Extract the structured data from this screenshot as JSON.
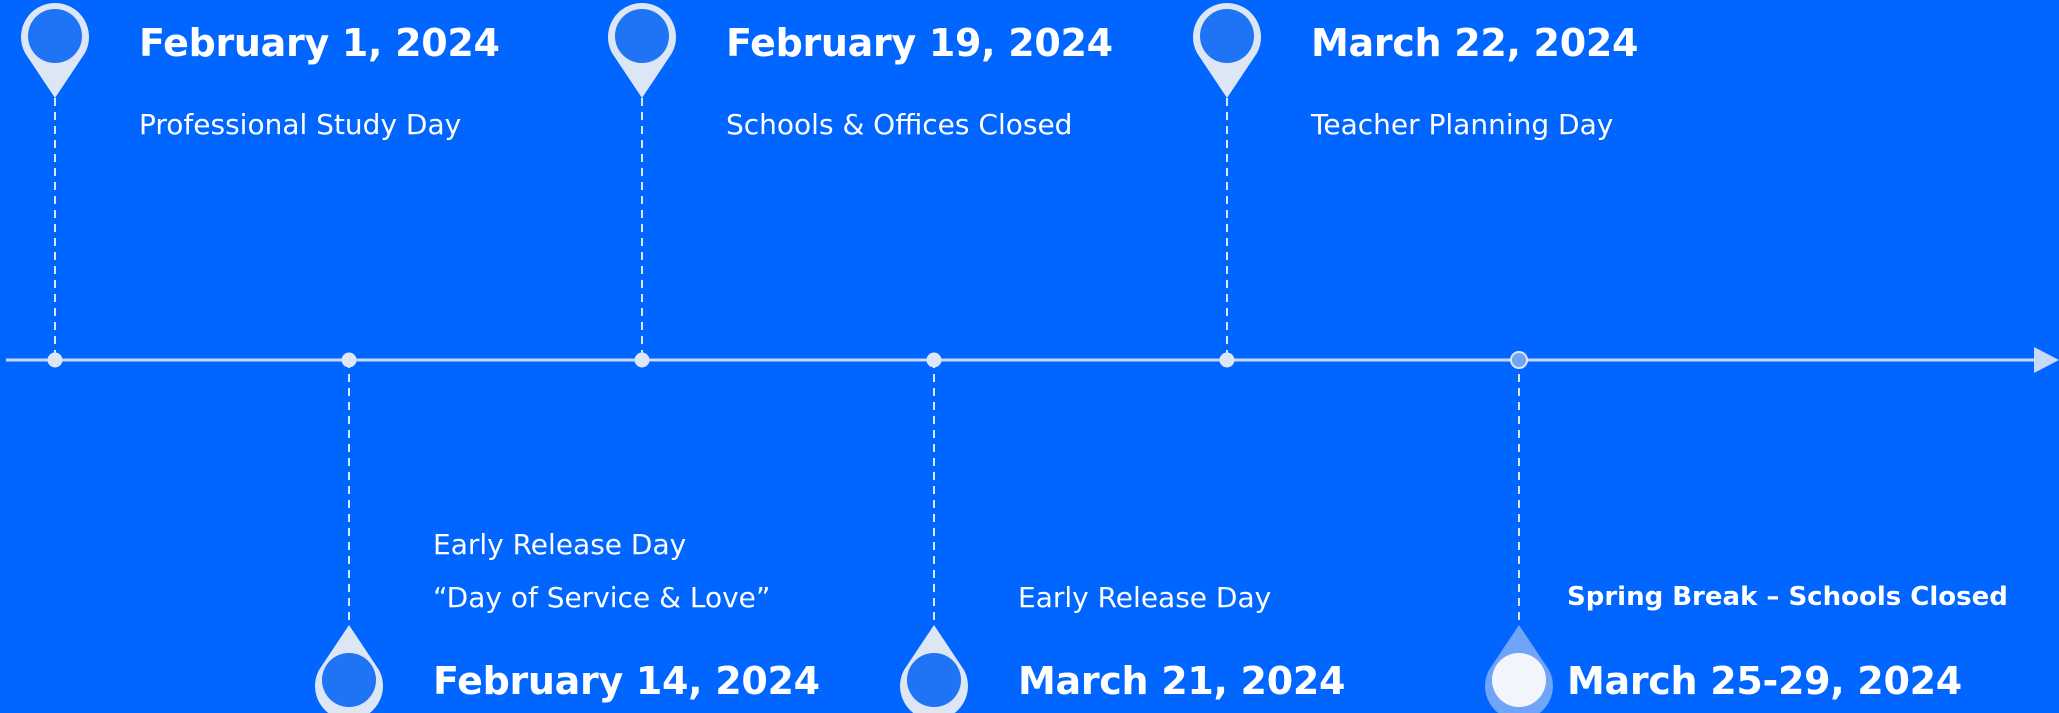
{
  "timeline": {
    "colors": {
      "background": "#0066FF",
      "line": "#C7D9F5",
      "marker_outer": "#DCE6F5",
      "marker_inner": "#1F73F5",
      "highlight_fill": "#F2F6FC",
      "text": "#FFFFFF"
    },
    "events": [
      {
        "date": "February 1, 2024",
        "description_lines": [
          "Professional Study Day"
        ],
        "side": "top",
        "highlighted": false
      },
      {
        "date": "February 14, 2024",
        "description_lines": [
          "Early Release Day",
          "“Day of Service & Love”"
        ],
        "side": "bottom",
        "highlighted": false
      },
      {
        "date": "February 19, 2024",
        "description_lines": [
          "Schools & Offices Closed"
        ],
        "side": "top",
        "highlighted": false
      },
      {
        "date": "March 21, 2024",
        "description_lines": [
          "Early Release Day"
        ],
        "side": "bottom",
        "highlighted": false
      },
      {
        "date": "March 22, 2024",
        "description_lines": [
          "Teacher Planning Day"
        ],
        "side": "top",
        "highlighted": false
      },
      {
        "date": "March 25-29, 2024",
        "description_lines": [
          "Spring Break – Schools Closed"
        ],
        "side": "bottom",
        "highlighted": true,
        "description_bold": true
      }
    ]
  }
}
